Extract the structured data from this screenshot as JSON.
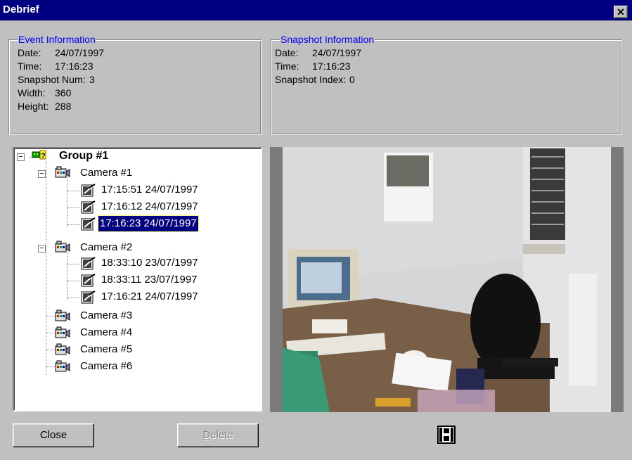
{
  "window": {
    "title": "Debrief",
    "close_glyph": "✕"
  },
  "event_info": {
    "legend": "Event Information",
    "date_label": "Date:",
    "date_value": "24/07/1997",
    "time_label": "Time:",
    "time_value": "17:16:23",
    "snapnum_label": "Snapshot Num:",
    "snapnum_value": "3",
    "width_label": "Width:",
    "width_value": "360",
    "height_label": "Height:",
    "height_value": "288"
  },
  "snapshot_info": {
    "legend": "Snapshot Information",
    "date_label": "Date:",
    "date_value": "24/07/1997",
    "time_label": "Time:",
    "time_value": "17:16:23",
    "index_label": "Snapshot Index:",
    "index_value": "0"
  },
  "tree": {
    "group": {
      "label": "Group #1",
      "icon": "group-icon",
      "expanded": true
    },
    "cameras": [
      {
        "label": "Camera #1",
        "expanded": true,
        "snapshots": [
          "17:15:51 24/07/1997",
          "17:16:12 24/07/1997",
          "17:16:23 24/07/1997"
        ],
        "selected_index": 2
      },
      {
        "label": "Camera #2",
        "expanded": true,
        "snapshots": [
          "18:33:10 23/07/1997",
          "18:33:11 23/07/1997",
          "17:16:21 24/07/1997"
        ]
      },
      {
        "label": "Camera #3"
      },
      {
        "label": "Camera #4"
      },
      {
        "label": "Camera #5"
      },
      {
        "label": "Camera #6"
      }
    ]
  },
  "preview": {
    "description_icon": "snapshot-image"
  },
  "buttons": {
    "close_label": "Close",
    "delete_first": "D",
    "delete_rest": "elete",
    "filmstrip_icon": "film-icon"
  },
  "colors": {
    "titlebar": "#000080",
    "legend_text": "#0000ff",
    "face": "#c0c0c0",
    "selection": "#000080"
  }
}
